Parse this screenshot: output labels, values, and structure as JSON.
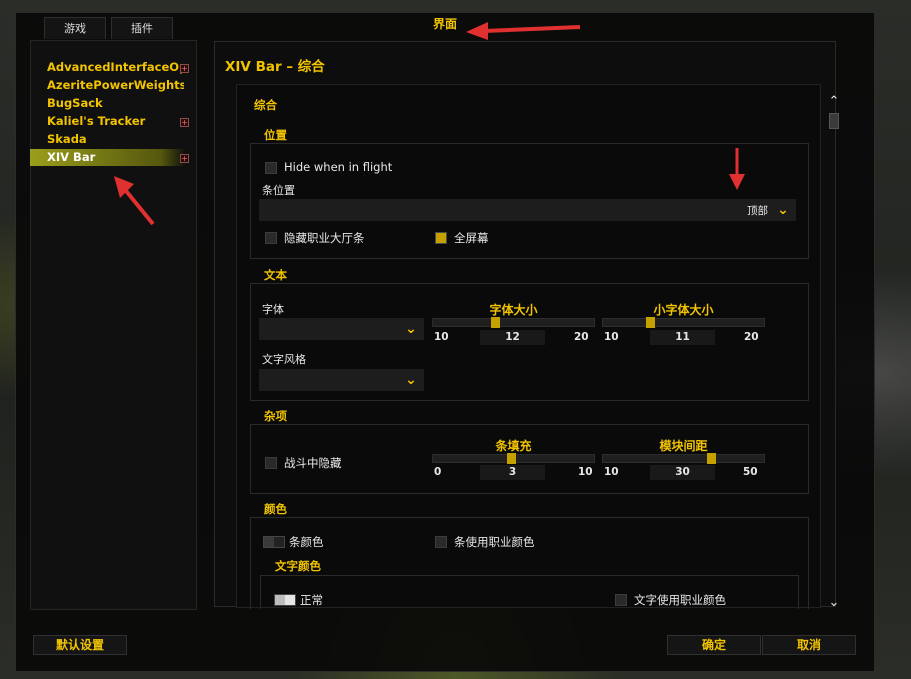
{
  "window": {
    "title": "界面"
  },
  "tabs": [
    {
      "label": "游戏"
    },
    {
      "label": "插件"
    }
  ],
  "addons": [
    {
      "label": "AdvancedInterfaceOpti...",
      "expandable": true,
      "selected": false
    },
    {
      "label": "AzeritePowerWeights",
      "expandable": false,
      "selected": false
    },
    {
      "label": "BugSack",
      "expandable": false,
      "selected": false
    },
    {
      "label": "Kaliel's Tracker",
      "expandable": true,
      "selected": false
    },
    {
      "label": "Skada",
      "expandable": false,
      "selected": false
    },
    {
      "label": "XIV Bar",
      "expandable": true,
      "selected": true
    }
  ],
  "panel": {
    "title": "XIV Bar – 综合",
    "section": "综合"
  },
  "position": {
    "label": "位置",
    "hide_in_flight": {
      "label": "Hide when in flight",
      "checked": false
    },
    "bar_position": {
      "label": "条位置",
      "value": "顶部"
    },
    "hide_order_hall": {
      "label": "隐藏职业大厅条",
      "checked": false
    },
    "fullscreen": {
      "label": "全屏幕",
      "checked": true
    }
  },
  "text": {
    "label": "文本",
    "font": {
      "label": "字体",
      "value": ""
    },
    "font_style": {
      "label": "文字风格",
      "value": ""
    },
    "font_size": {
      "label": "字体大小",
      "min": "10",
      "max": "20",
      "value": "12",
      "fraction": 0.2
    },
    "small_font_size": {
      "label": "小字体大小",
      "min": "10",
      "max": "20",
      "value": "11",
      "fraction": 0.1
    }
  },
  "misc": {
    "label": "杂项",
    "hide_in_combat": {
      "label": "战斗中隐藏",
      "checked": false
    },
    "bar_padding": {
      "label": "条填充",
      "min": "0",
      "max": "10",
      "value": "3",
      "fraction": 0.3
    },
    "module_spacing": {
      "label": "模块间距",
      "min": "10",
      "max": "50",
      "value": "30",
      "fraction": 0.5
    }
  },
  "colors": {
    "label": "颜色",
    "bar_color": {
      "label": "条颜色"
    },
    "bar_class_color": {
      "label": "条使用职业颜色",
      "checked": false
    },
    "text_color_label": "文字颜色",
    "normal": {
      "label": "正常"
    },
    "text_class_color": {
      "label": "文字使用职业颜色",
      "checked": false
    }
  },
  "buttons": {
    "defaults": "默认设置",
    "ok": "确定",
    "cancel": "取消"
  },
  "scrollbar": {
    "up": "⌃",
    "down": "⌄"
  },
  "accent": "#f2c400",
  "checked_color": "#c4a000"
}
